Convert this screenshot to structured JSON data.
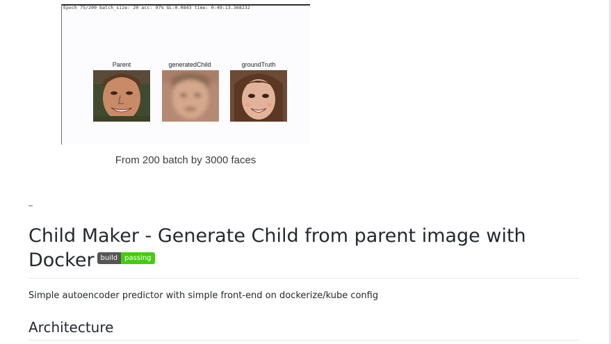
{
  "figure": {
    "header": "Epoch 75/200 batch_size: 20 acc:  97%  GL:0.0843  time: 0:49:13.368232",
    "labels": [
      "Parent",
      "generatedChild",
      "groundTruth"
    ],
    "caption": "From 200 batch by 3000 faces"
  },
  "readme": {
    "dash": "–",
    "title": "Child Maker - Generate Child from parent image with Docker",
    "badge": {
      "left": "build",
      "right": "passing"
    },
    "description": "Simple autoencoder predictor with simple front-end on dockerize/kube config",
    "section_heading": "Architecture"
  },
  "colors": {
    "badge_left": "#555555",
    "badge_right": "#44cc11",
    "text": "#24292e"
  }
}
